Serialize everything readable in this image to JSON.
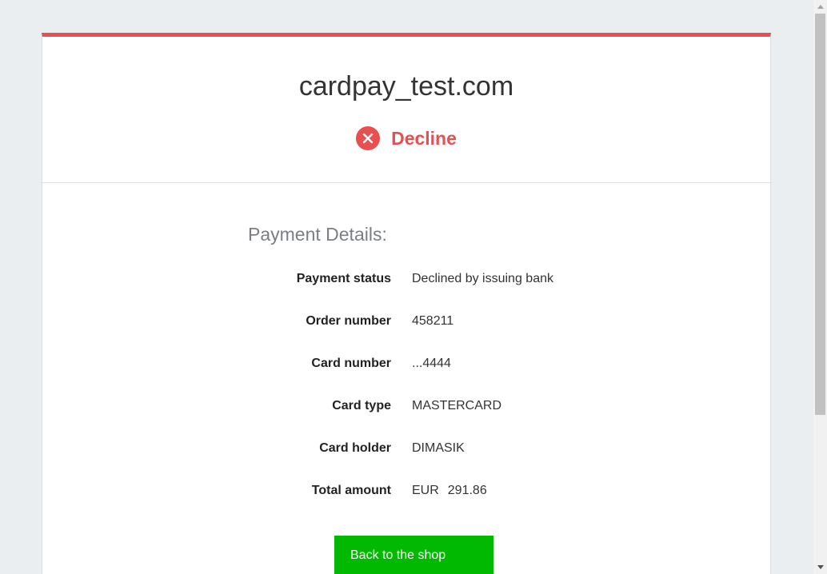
{
  "header": {
    "merchant_name": "cardpay_test.com",
    "status": "Decline"
  },
  "details": {
    "title": "Payment Details:",
    "rows": [
      {
        "label": "Payment status",
        "value": "Declined by issuing bank"
      },
      {
        "label": "Order number",
        "value": "458211"
      },
      {
        "label": "Card number",
        "value": "...4444"
      },
      {
        "label": "Card type",
        "value": "MASTERCARD"
      },
      {
        "label": "Card holder",
        "value": "DIMASIK"
      },
      {
        "label": "Total amount",
        "currency": "EUR",
        "amount": "291.86"
      }
    ]
  },
  "actions": {
    "back_label": "Back to the shop"
  },
  "icons": {
    "status": "decline-x-circle-icon"
  },
  "colors": {
    "accent": "#e84f4f",
    "button": "#00b900",
    "background": "#ebeef1"
  }
}
